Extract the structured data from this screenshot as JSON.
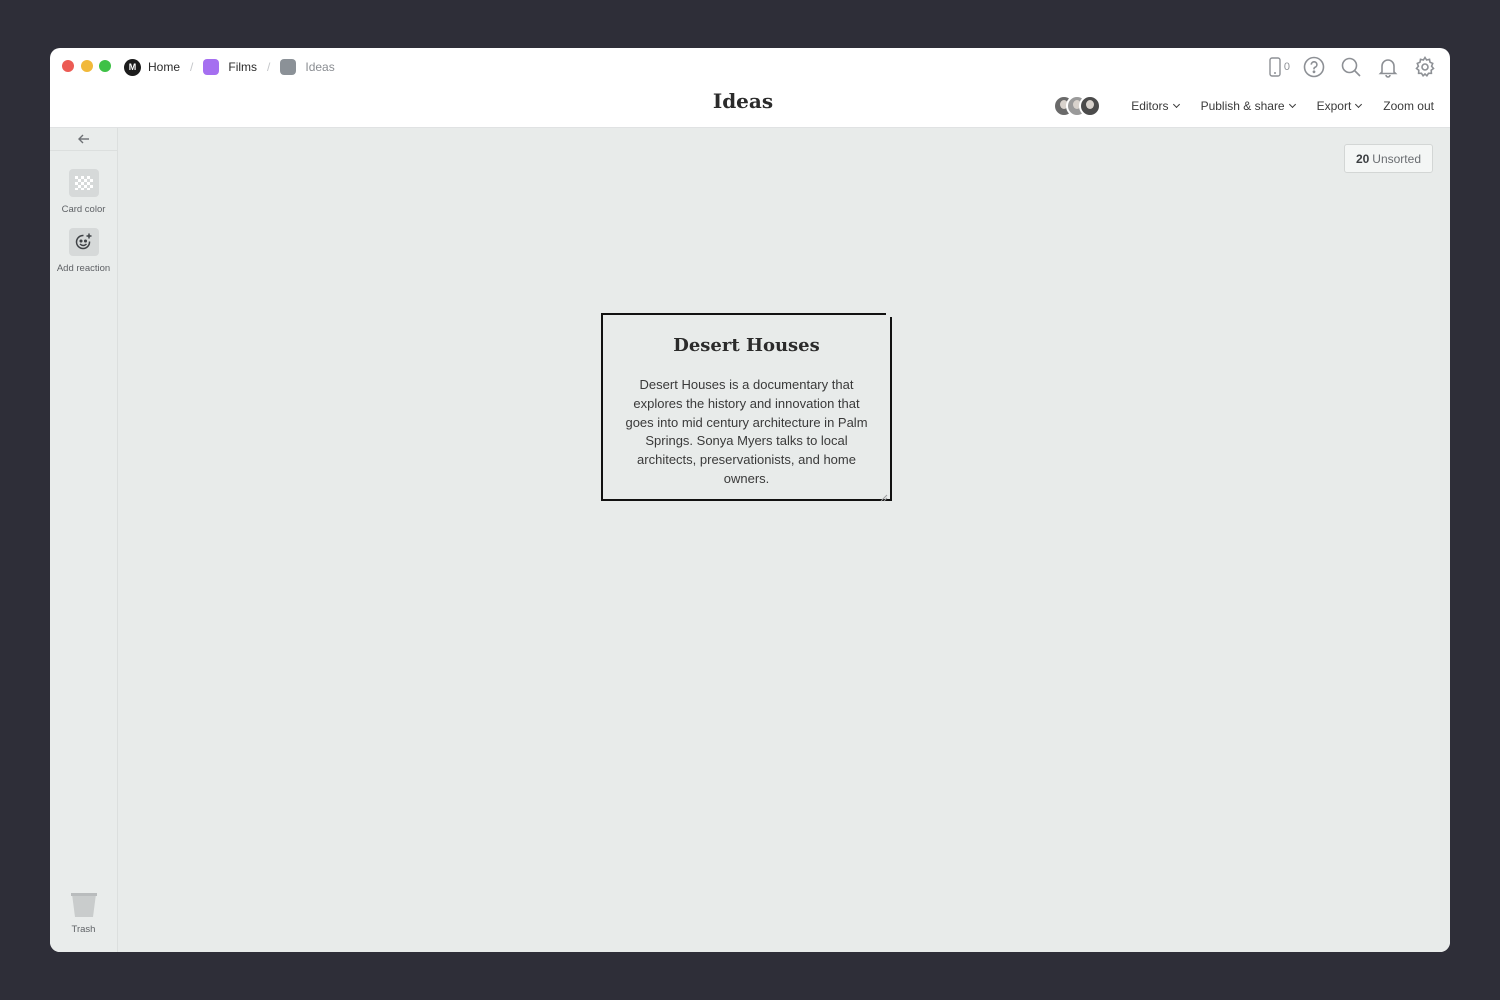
{
  "breadcrumb": [
    {
      "label": "Home",
      "icon": "milanote-logo-icon"
    },
    {
      "label": "Films",
      "color": "#a56ff0"
    },
    {
      "label": "Ideas",
      "color": "#8b9197"
    }
  ],
  "top_icons": {
    "device_count": "0"
  },
  "header": {
    "title": "Ideas",
    "editors_label": "Editors",
    "publish_label": "Publish & share",
    "export_label": "Export",
    "zoom_label": "Zoom out"
  },
  "sidebar": {
    "card_color_label": "Card color",
    "add_reaction_label": "Add reaction",
    "trash_label": "Trash"
  },
  "canvas": {
    "unsorted_count": "20",
    "unsorted_label": "Unsorted",
    "card": {
      "title": "Desert Houses",
      "body": "Desert Houses is a documentary that explores the history and innovation that goes into mid century architecture in Palm Springs. Sonya Myers talks to local architects, preservationists, and home owners."
    }
  }
}
